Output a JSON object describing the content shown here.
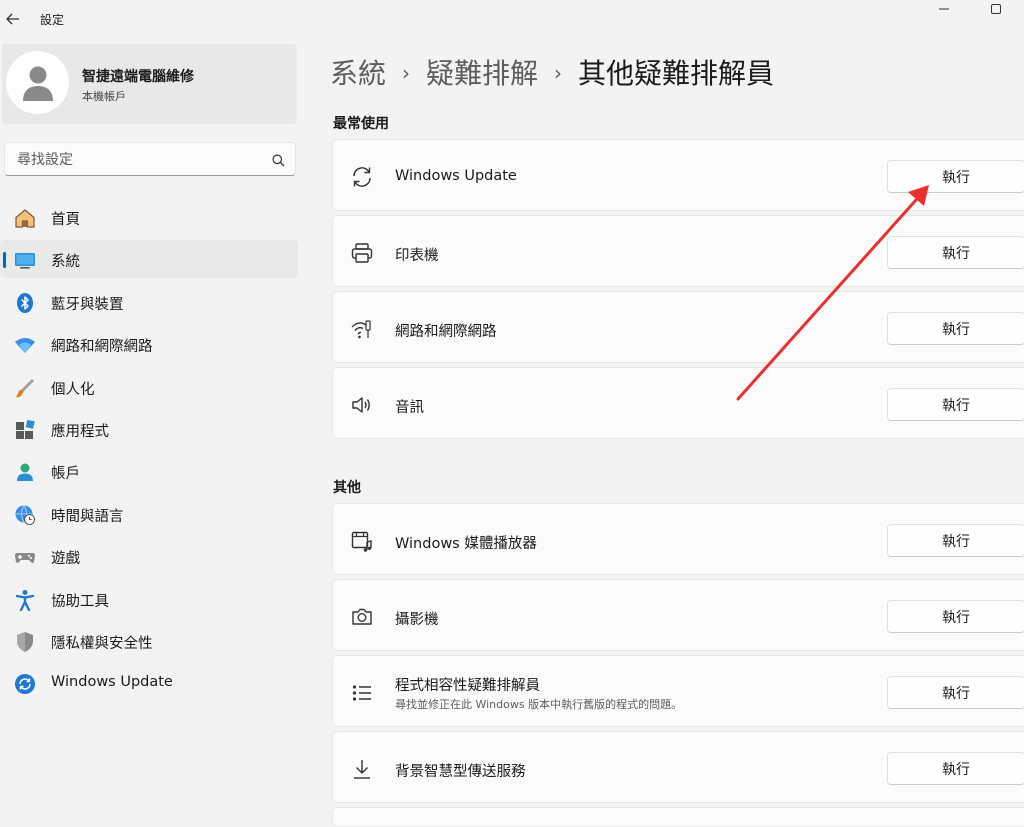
{
  "window": {
    "title": "設定"
  },
  "profile": {
    "name": "智捷遠端電腦維修",
    "account_type": "本機帳戶"
  },
  "search": {
    "placeholder": "尋找設定"
  },
  "nav": {
    "items": [
      {
        "label": "首頁",
        "icon": "home-icon"
      },
      {
        "label": "系統",
        "icon": "system-icon",
        "active": true
      },
      {
        "label": "藍牙與裝置",
        "icon": "bluetooth-icon"
      },
      {
        "label": "網路和網際網路",
        "icon": "wifi-icon"
      },
      {
        "label": "個人化",
        "icon": "brush-icon"
      },
      {
        "label": "應用程式",
        "icon": "apps-icon"
      },
      {
        "label": "帳戶",
        "icon": "account-icon"
      },
      {
        "label": "時間與語言",
        "icon": "globe-clock-icon"
      },
      {
        "label": "遊戲",
        "icon": "gamepad-icon"
      },
      {
        "label": "協助工具",
        "icon": "accessibility-icon"
      },
      {
        "label": "隱私權與安全性",
        "icon": "shield-icon"
      },
      {
        "label": "Windows Update",
        "icon": "windows-update-icon"
      }
    ]
  },
  "breadcrumb": {
    "level1": "系統",
    "level2": "疑難排解",
    "current": "其他疑難排解員",
    "separator": "›"
  },
  "sections": {
    "frequent": {
      "label": "最常使用",
      "items": [
        {
          "title": "Windows Update",
          "icon": "refresh-icon",
          "button": "執行"
        },
        {
          "title": "印表機",
          "icon": "printer-icon",
          "button": "執行"
        },
        {
          "title": "網路和網際網路",
          "icon": "network-icon",
          "button": "執行"
        },
        {
          "title": "音訊",
          "icon": "speaker-icon",
          "button": "執行"
        }
      ]
    },
    "other": {
      "label": "其他",
      "items": [
        {
          "title": "Windows 媒體播放器",
          "icon": "media-player-icon",
          "button": "執行"
        },
        {
          "title": "攝影機",
          "icon": "camera-icon",
          "button": "執行"
        },
        {
          "title": "程式相容性疑難排解員",
          "subtitle": "尋找並修正在此 Windows 版本中執行舊版的程式的問題。",
          "icon": "list-icon",
          "button": "執行"
        },
        {
          "title": "背景智慧型傳送服務",
          "icon": "download-icon",
          "button": "執行"
        }
      ]
    }
  },
  "colors": {
    "accent": "#0067c0",
    "annotation_arrow": "#e8312f"
  }
}
